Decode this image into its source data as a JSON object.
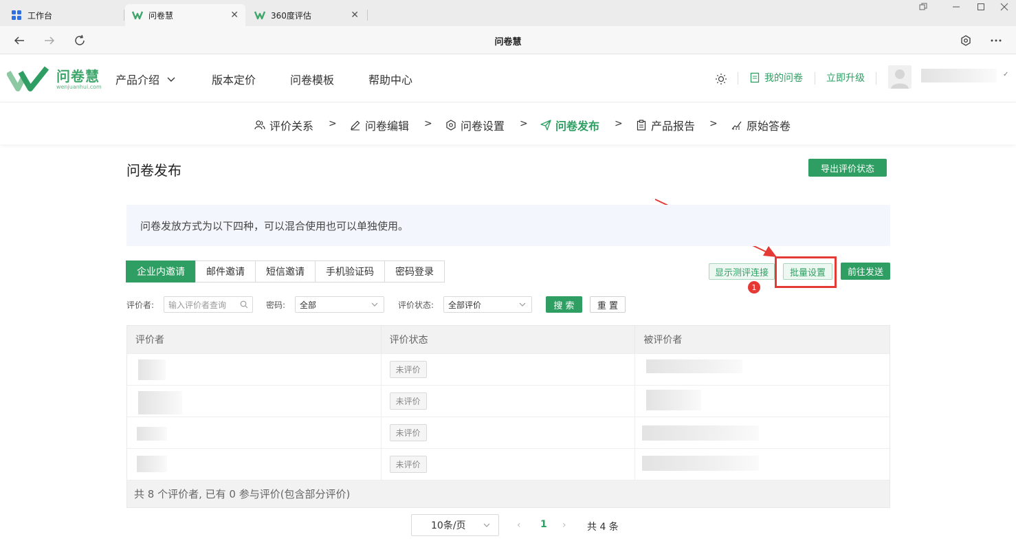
{
  "browser": {
    "tabs": [
      {
        "title": "工作台"
      },
      {
        "title": "问卷慧"
      },
      {
        "title": "360度评估"
      }
    ],
    "address_title": "问卷慧"
  },
  "site": {
    "logo_text": "问卷慧",
    "logo_sub": "wenjuanhui.com",
    "nav": {
      "product": "产品介绍",
      "pricing": "版本定价",
      "templates": "问卷模板",
      "help": "帮助中心"
    },
    "my_surveys": "我的问卷",
    "upgrade": "立即升级"
  },
  "steps": {
    "relation": "评价关系",
    "edit": "问卷编辑",
    "settings": "问卷设置",
    "publish": "问卷发布",
    "report": "产品报告",
    "raw": "原始答卷",
    "separator": ">"
  },
  "page": {
    "title": "问卷发布",
    "export_button": "导出评价状态",
    "notice": "问卷发放方式为以下四种，可以混合使用也可以单独使用。"
  },
  "invite_tabs": {
    "enterprise": "企业内邀请",
    "email": "邮件邀请",
    "sms": "短信邀请",
    "phone_code": "手机验证码",
    "password": "密码登录"
  },
  "actions": {
    "show_link": "显示测评连接",
    "batch_settings": "批量设置",
    "go_send": "前往发送",
    "badge": "1"
  },
  "filters": {
    "evaluator_label": "评价者:",
    "evaluator_placeholder": "输入评价者查询",
    "password_label": "密码:",
    "password_value": "全部",
    "status_label": "评价状态:",
    "status_value": "全部评价",
    "search": "搜 索",
    "reset": "重 置"
  },
  "table": {
    "headers": {
      "evaluator": "评价者",
      "status": "评价状态",
      "evaluatee": "被评价者"
    },
    "rows": [
      {
        "status": "未评价"
      },
      {
        "status": "未评价"
      },
      {
        "status": "未评价"
      },
      {
        "status": "未评价"
      }
    ],
    "summary": "共 8 个评价者, 已有 0 参与评价(包含部分评价)"
  },
  "pagination": {
    "page_size": "10条/页",
    "current_page": "1",
    "total": "共 4 条"
  },
  "colors": {
    "brand_green": "#2e9e62",
    "highlight_red": "#e53935"
  }
}
